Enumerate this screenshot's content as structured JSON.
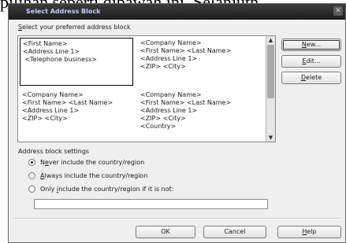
{
  "background_text": "pilihan seperti dibawah ini. Selanjutn",
  "dialog": {
    "title": "Select Address Block",
    "close_glyph": "✕"
  },
  "address_list": {
    "label_prefix": "",
    "label_mnemonic": "S",
    "label_rest": "elect your preferred address block",
    "blocks": [
      {
        "text": "<First Name>\n<Address Line 1>\n <Telephone business>",
        "selected": true
      },
      {
        "text": "<Company Name>\n<First Name> <Last Name>\n<Address Line 1>\n<ZIP> <City>",
        "selected": false
      },
      {
        "text": "<Company Name>\n<First Name> <Last Name>\n<Address Line 1>\n<ZIP> <City>",
        "selected": false
      },
      {
        "text": "<Company Name>\n<First Name> <Last Name>\n<Address Line 1>\n<ZIP> <City>\n<Country>",
        "selected": false
      }
    ],
    "scroll_up_glyph": "▲",
    "scroll_down_glyph": "▼"
  },
  "side_buttons": {
    "new_prefix": "",
    "new_mnemonic": "N",
    "new_rest": "ew...",
    "edit_prefix": "",
    "edit_mnemonic": "E",
    "edit_rest": "dit...",
    "delete_prefix": "",
    "delete_mnemonic": "D",
    "delete_rest": "elete"
  },
  "settings": {
    "label": "Address block settings",
    "options": [
      {
        "prefix": "N",
        "mnemonic": "e",
        "rest": "ver include the country/region",
        "checked": true
      },
      {
        "prefix": "",
        "mnemonic": "A",
        "rest": "lways include the country/region",
        "checked": false
      },
      {
        "prefix": "Only ",
        "mnemonic": "i",
        "rest": "nclude the country/region if it is not:",
        "checked": false
      }
    ],
    "country_value": ""
  },
  "footer": {
    "ok_label": "OK",
    "cancel_label": "Cancel",
    "help_prefix": "",
    "help_mnemonic": "H",
    "help_rest": "elp"
  },
  "colors": {
    "title_text": "#c9c9ff",
    "title_bar": "#2a2a2a",
    "dialog_bg": "#efefef"
  }
}
